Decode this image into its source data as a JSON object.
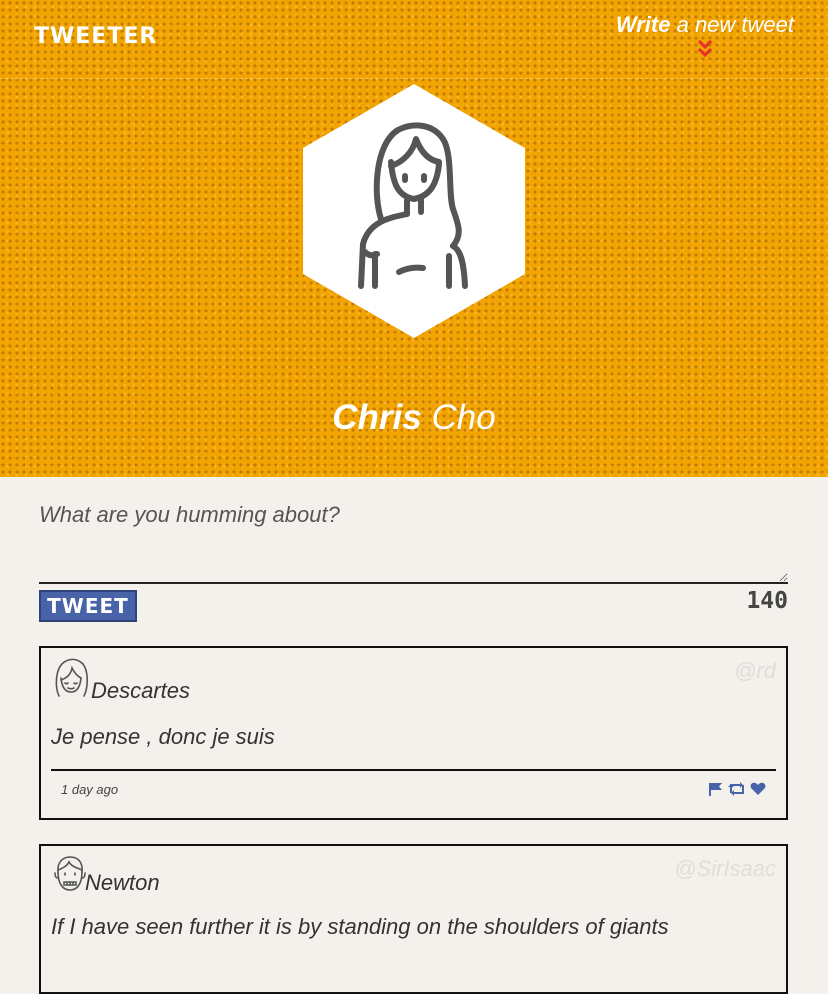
{
  "header": {
    "brand": "TWEETER",
    "write_strong": "Write",
    "write_rest": " a new tweet",
    "write_chevron": "»"
  },
  "profile": {
    "first_name": "Chris",
    "last_name": "Cho"
  },
  "compose": {
    "placeholder": "What are you humming about?",
    "button_label": "TWEET",
    "char_count": "140"
  },
  "tweets": [
    {
      "name": "Descartes",
      "handle": "@rd",
      "text": "Je pense , donc je suis",
      "time": "1 day ago",
      "avatar_icon": "girl-avatar-icon"
    },
    {
      "name": "Newton",
      "handle": "@SirIsaac",
      "text": "If I have seen further it is by standing on the shoulders of giants",
      "avatar_icon": "man-avatar-icon"
    }
  ],
  "colors": {
    "hero_orange": "#f2a400",
    "chevron_red": "#e8302a",
    "button_blue": "#4863a8",
    "action_blue": "#4863a8",
    "page_bg": "#f4f1ed"
  }
}
